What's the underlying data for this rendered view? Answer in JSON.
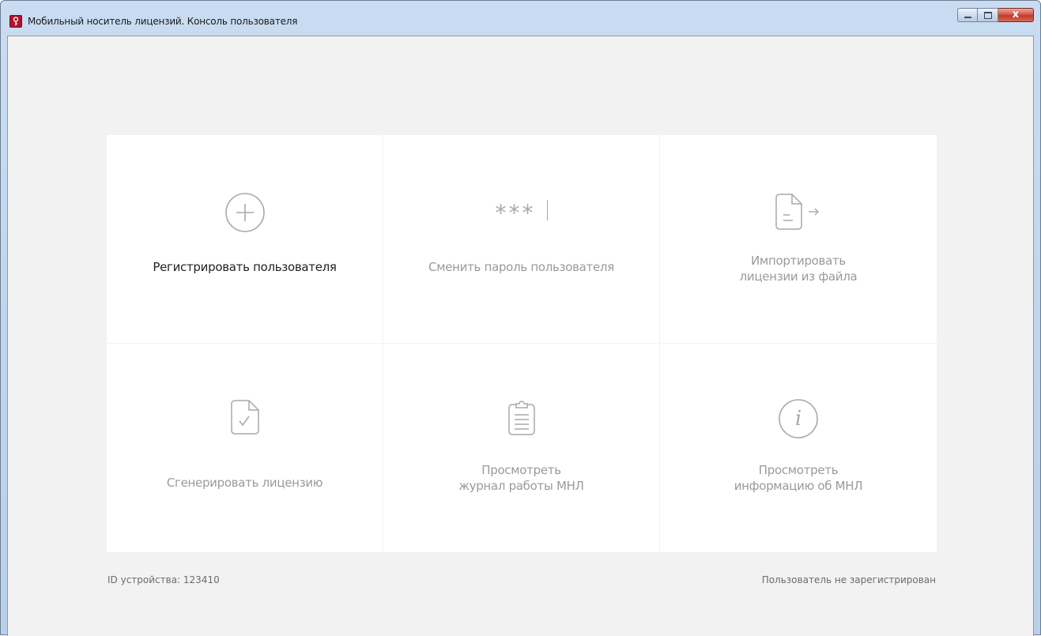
{
  "window": {
    "title": "Мобильный носитель лицензий. Консоль пользователя",
    "close_glyph": "x"
  },
  "tiles": [
    {
      "line1": "Регистрировать пользователя",
      "line2": "",
      "icon": "plus-circle-icon"
    },
    {
      "line1": "Сменить пароль пользователя",
      "line2": "",
      "icon": "password-icon",
      "glyph": "***"
    },
    {
      "line1": "Импортировать",
      "line2": "лицензии из файла",
      "icon": "import-file-icon"
    },
    {
      "line1": "Сгенерировать лицензию",
      "line2": "",
      "icon": "license-check-icon"
    },
    {
      "line1": "Просмотреть",
      "line2": "журнал работы МНЛ",
      "icon": "clipboard-log-icon"
    },
    {
      "line1": "Просмотреть",
      "line2": "информацию об МНЛ",
      "icon": "info-circle-icon",
      "glyph": "i"
    }
  ],
  "footer": {
    "device_id": "ID устройства: 123410",
    "user_status": "Пользователь не зарегистрирован"
  },
  "colors": {
    "accent": "#b0142c",
    "tile_bg": "#ffffff",
    "page_bg": "#f2f2f2",
    "icon_stroke": "#a8a8a8",
    "active_text": "#222222",
    "muted_text": "#9a9a9a"
  }
}
